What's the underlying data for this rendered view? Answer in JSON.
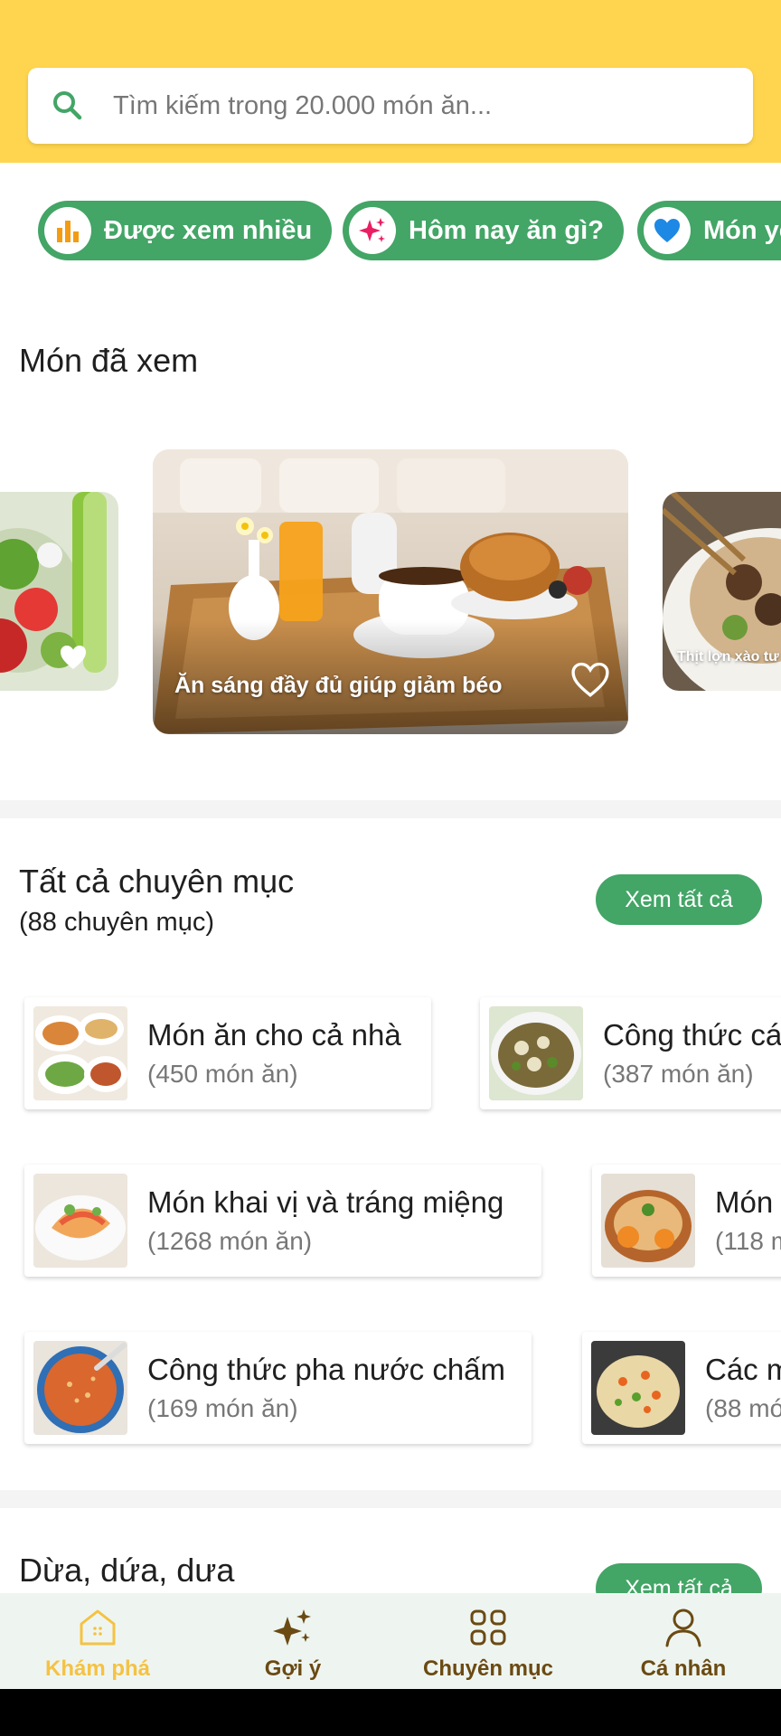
{
  "search": {
    "placeholder": "Tìm kiếm trong 20.000 món ăn..."
  },
  "chips": [
    {
      "label": "Được xem nhiều",
      "icon": "bar-chart-icon"
    },
    {
      "label": "Hôm nay ăn gì?",
      "icon": "sparkle-icon"
    },
    {
      "label": "Món yêu thích",
      "icon": "heart-icon"
    }
  ],
  "viewed": {
    "title": "Món đã xem",
    "cards": [
      {
        "caption": ""
      },
      {
        "caption": "Ăn sáng đầy đủ giúp giảm béo"
      },
      {
        "caption": "Thịt lợn xào tư"
      }
    ]
  },
  "categories": {
    "title": "Tất cả chuyên mục",
    "subtitle": "(88 chuyên mục)",
    "see_all": "Xem tất cả",
    "items": [
      {
        "name": "Món ăn cho cả nhà",
        "count": "(450 món ăn)"
      },
      {
        "name": "Công thức cá",
        "count": "(387 món ăn)"
      },
      {
        "name": "Món khai vị và tráng miệng",
        "count": "(1268 món ăn)"
      },
      {
        "name": "Món",
        "count": "(118 m"
      },
      {
        "name": "Công thức pha nước chấm",
        "count": "(169 món ăn)"
      },
      {
        "name": "Các m",
        "count": "(88 mó"
      }
    ]
  },
  "next_section": {
    "title": "Dừa, dứa, dưa",
    "see_all": "Xem tất cả"
  },
  "nav": [
    {
      "label": "Khám phá",
      "active": true
    },
    {
      "label": "Gợi ý",
      "active": false
    },
    {
      "label": "Chuyên mục",
      "active": false
    },
    {
      "label": "Cá nhân",
      "active": false
    }
  ],
  "colors": {
    "header": "#ffd54f",
    "accent": "#43a566",
    "nav_active": "#f5c242",
    "nav_inactive": "#6b4a12"
  }
}
